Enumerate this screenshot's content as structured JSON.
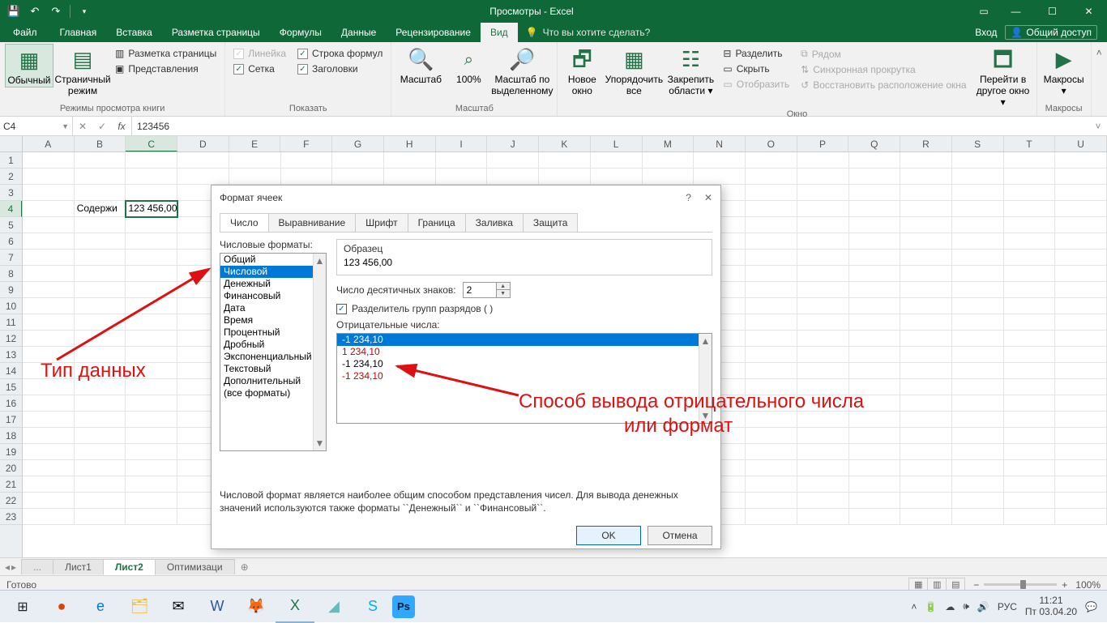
{
  "titlebar": {
    "title": "Просмотры - Excel"
  },
  "login": "Вход",
  "share": "Общий доступ",
  "tabs": {
    "file": "Файл",
    "home": "Главная",
    "insert": "Вставка",
    "layout": "Разметка страницы",
    "formulas": "Формулы",
    "data": "Данные",
    "review": "Рецензирование",
    "view": "Вид",
    "tell": "Что вы хотите сделать?"
  },
  "ribbon": {
    "views": {
      "normal": "Обычный",
      "pagebreak": "Страничный\nрежим",
      "pagelayout": "Разметка страницы",
      "custom": "Представления",
      "group": "Режимы просмотра книги"
    },
    "show": {
      "ruler": "Линейка",
      "grid": "Сетка",
      "fbar": "Строка формул",
      "headings": "Заголовки",
      "group": "Показать"
    },
    "zoom": {
      "zoom": "Масштаб",
      "z100": "100%",
      "zsel": "Масштаб по\nвыделенному",
      "group": "Масштаб"
    },
    "window": {
      "newwin": "Новое\nокно",
      "arrange": "Упорядочить\nвсе",
      "freeze": "Закрепить\nобласти ▾",
      "split": "Разделить",
      "hide": "Скрыть",
      "unhide": "Отобразить",
      "side": "Рядом",
      "sync": "Синхронная прокрутка",
      "reset": "Восстановить расположение окна",
      "switch": "Перейти в\nдругое окно ▾",
      "group": "Окно"
    },
    "macros": {
      "macros": "Макросы\n▾",
      "group": "Макросы"
    }
  },
  "namebox": "C4",
  "formula": "123456",
  "cols": [
    "A",
    "B",
    "C",
    "D",
    "E",
    "F",
    "G",
    "H",
    "I",
    "J",
    "K",
    "L",
    "M",
    "N",
    "O",
    "P",
    "Q",
    "R",
    "S",
    "T",
    "U"
  ],
  "rows": [
    "1",
    "2",
    "3",
    "4",
    "5",
    "6",
    "7",
    "8",
    "9",
    "10",
    "11",
    "12",
    "13",
    "14",
    "15",
    "16",
    "17",
    "18",
    "19",
    "20",
    "21",
    "22",
    "23"
  ],
  "celldata": {
    "B4": "Содержи",
    "C4": "123 456,00"
  },
  "sheets": {
    "ell": "...",
    "s1": "Лист1",
    "s2": "Лист2",
    "s3": "Оптимизаци"
  },
  "status": {
    "ready": "Готово",
    "zoom": "100%"
  },
  "dialog": {
    "title": "Формат ячеек",
    "tabs": [
      "Число",
      "Выравнивание",
      "Шрифт",
      "Граница",
      "Заливка",
      "Защита"
    ],
    "catlabel": "Числовые форматы:",
    "cats": [
      "Общий",
      "Числовой",
      "Денежный",
      "Финансовый",
      "Дата",
      "Время",
      "Процентный",
      "Дробный",
      "Экспоненциальный",
      "Текстовый",
      "Дополнительный",
      "(все форматы)"
    ],
    "sample_label": "Образец",
    "sample_value": "123 456,00",
    "decimals_label": "Число десятичных знаков:",
    "decimals_value": "2",
    "sep_label": "Разделитель групп разрядов ( )",
    "neg_label": "Отрицательные числа:",
    "neg": [
      "-1 234,10",
      "1 234,10",
      "-1 234,10",
      "-1 234,10"
    ],
    "desc": "Числовой формат является наиболее общим способом представления чисел. Для вывода денежных значений используются также форматы ``Денежный`` и ``Финансовый``.",
    "ok": "OK",
    "cancel": "Отмена"
  },
  "anno": {
    "left": "Тип данных",
    "right1": "Способ вывода отрицательного числа",
    "right2": "или формат"
  },
  "taskbar": {
    "lang": "РУС",
    "time": "11:21",
    "date": "Пт 03.04.20"
  }
}
